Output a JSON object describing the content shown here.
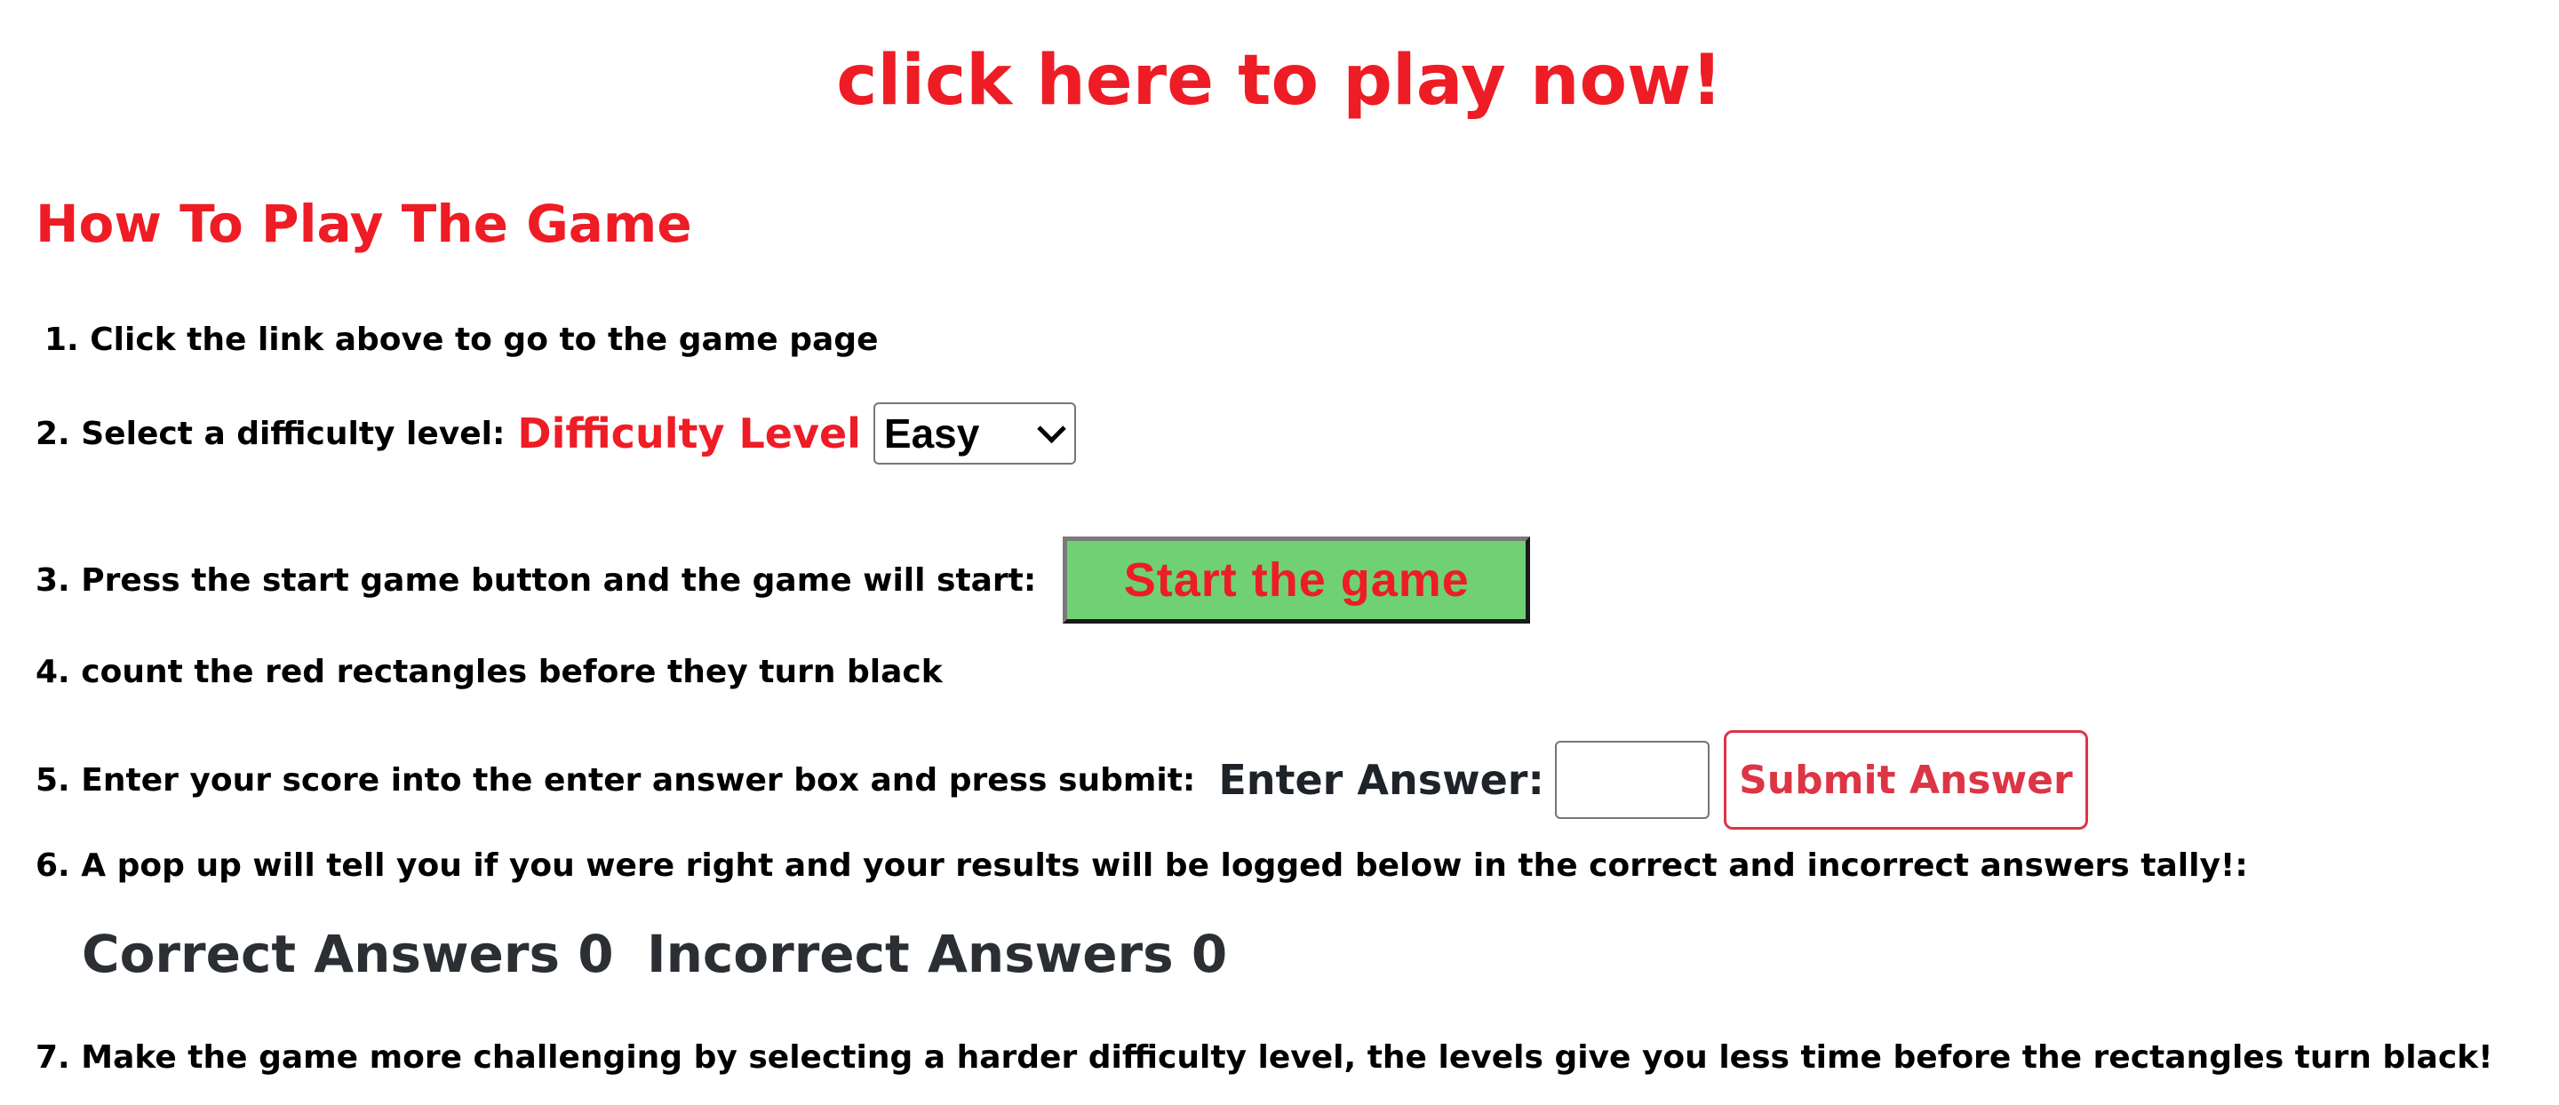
{
  "header": {
    "play_link": "click here to play now!"
  },
  "instructions": {
    "title": "How To Play The Game",
    "step1": "1. Click the link above to go to the game page",
    "step2": "2. Select a difficulty level:",
    "difficulty_label": "Difficulty Level",
    "difficulty_selected": "Easy",
    "step3": "3. Press the start game button and the game will start:",
    "start_button": "Start the game",
    "step4": "4. count the red rectangles before they turn black",
    "step5": "5. Enter your score into the enter answer box and press submit:",
    "answer_label": "Enter Answer:",
    "answer_value": "",
    "submit_button": "Submit Answer",
    "step6": "6. A pop up will tell you if you were right and your results will be logged below in the correct and incorrect answers tally!:",
    "correct_tally": "Correct Answers 0",
    "incorrect_tally": "Incorrect Answers 0",
    "step7": "7. Make the game more challenging by selecting a harder difficulty level, the levels give you less time before the rectangles turn black!"
  },
  "colors": {
    "accent_red": "#ee1c25",
    "start_button_bg": "#6fd173",
    "submit_border": "#dc3545",
    "tally_text": "#2b2f33"
  }
}
